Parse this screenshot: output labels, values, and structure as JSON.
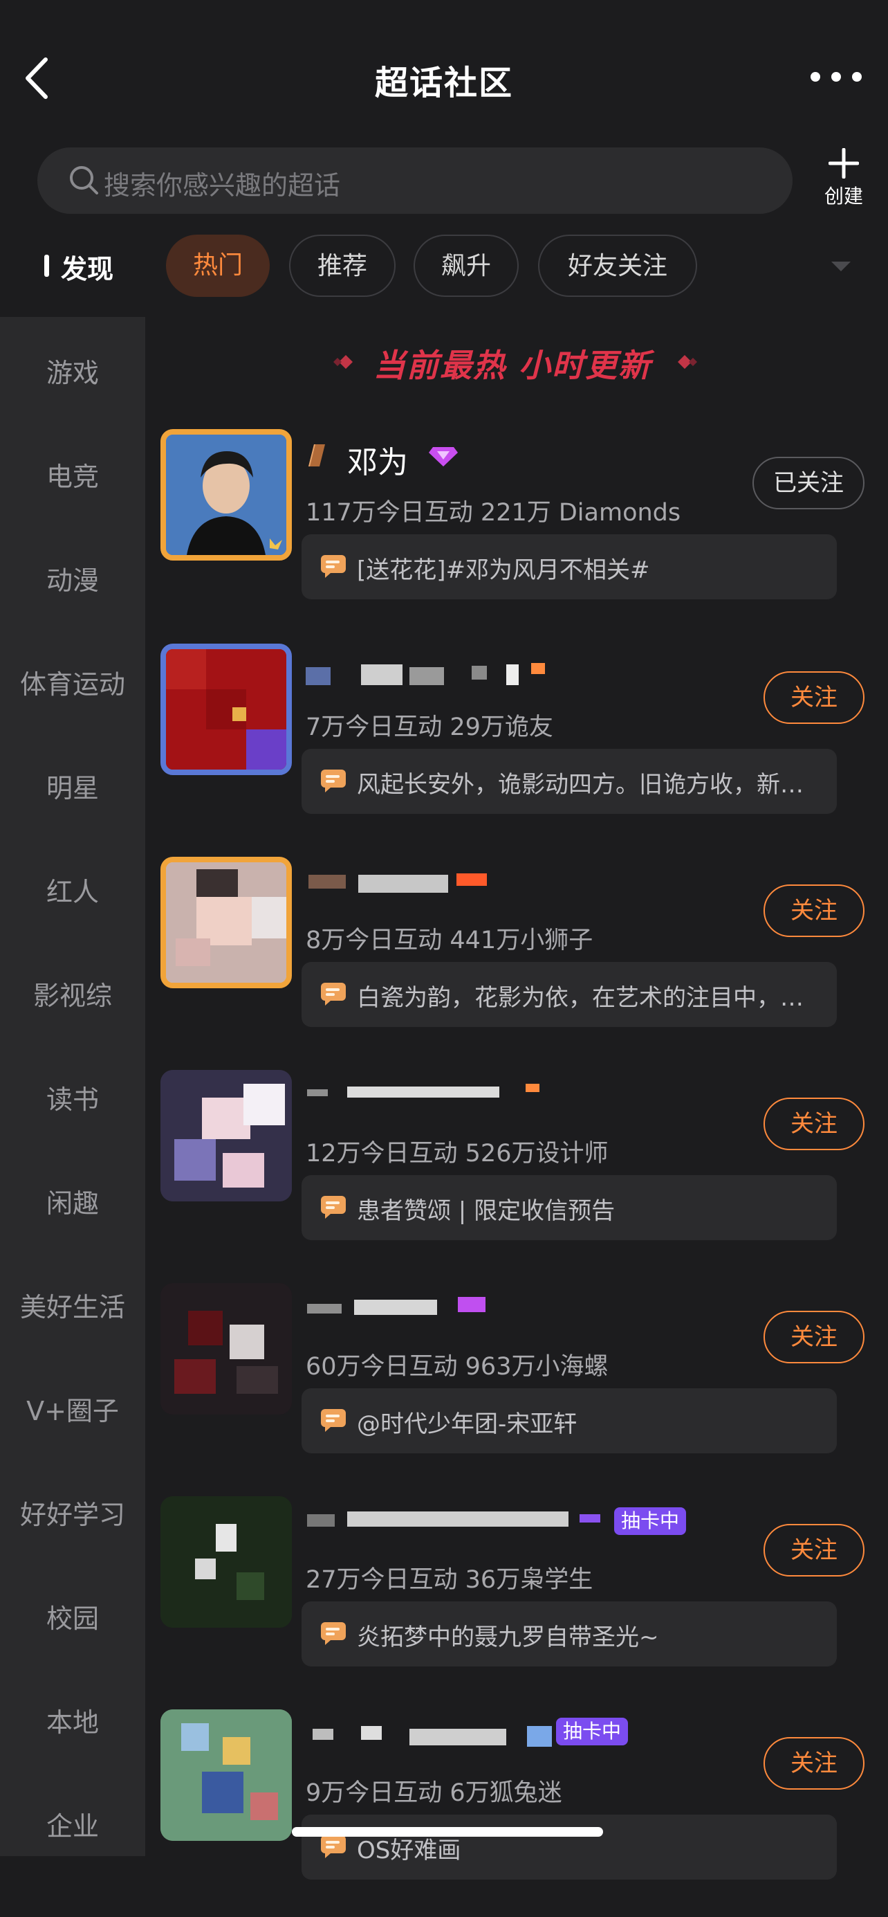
{
  "header": {
    "title": "超话社区"
  },
  "search": {
    "placeholder": "搜索你感兴趣的超话",
    "create_label": "创建"
  },
  "filters": {
    "section_label": "发现",
    "chips": [
      {
        "label": "热门",
        "active": true
      },
      {
        "label": "推荐",
        "active": false
      },
      {
        "label": "飙升",
        "active": false
      },
      {
        "label": "好友关注",
        "active": false
      }
    ]
  },
  "sidebar": {
    "items": [
      "游戏",
      "电竞",
      "动漫",
      "体育运动",
      "明星",
      "红人",
      "影视综",
      "读书",
      "闲趣",
      "美好生活",
      "V+圈子",
      "好好学习",
      "校园",
      "本地",
      "企业"
    ]
  },
  "banner": {
    "text": "当前最热 小时更新"
  },
  "communities": [
    {
      "name": "邓为",
      "stats": "117万今日互动 221万 Diamonds",
      "post": "[送花花]#邓为风月不相关#",
      "follow": "已关注",
      "followed": true,
      "badge": ""
    },
    {
      "name": "",
      "stats": "7万今日互动 29万诡友",
      "post": "风起长安外，诡影动四方。旧诡方收，新…",
      "follow": "关注",
      "followed": false,
      "badge": ""
    },
    {
      "name": "",
      "stats": "8万今日互动 441万小狮子",
      "post": "白瓷为韵，花影为依，在艺术的注目中，…",
      "follow": "关注",
      "followed": false,
      "badge": ""
    },
    {
      "name": "",
      "stats": "12万今日互动 526万设计师",
      "post": "患者赞颂 | 限定收信预告",
      "follow": "关注",
      "followed": false,
      "badge": ""
    },
    {
      "name": "",
      "stats": "60万今日互动 963万小海螺",
      "post": "@时代少年团-宋亚轩",
      "follow": "关注",
      "followed": false,
      "badge": ""
    },
    {
      "name": "",
      "stats": "27万今日互动 36万枭学生",
      "post": "炎拓梦中的聂九罗自带圣光~",
      "follow": "关注",
      "followed": false,
      "badge": "抽卡中"
    },
    {
      "name": "",
      "stats": "9万今日互动 6万狐兔迷",
      "post": "OS好难画",
      "follow": "关注",
      "followed": false,
      "badge": "抽卡中"
    }
  ],
  "colors": {
    "accent": "#ff8a3d",
    "banner": "#e0344a",
    "background": "#1c1c1e",
    "sidebar": "#2a2a2c"
  }
}
